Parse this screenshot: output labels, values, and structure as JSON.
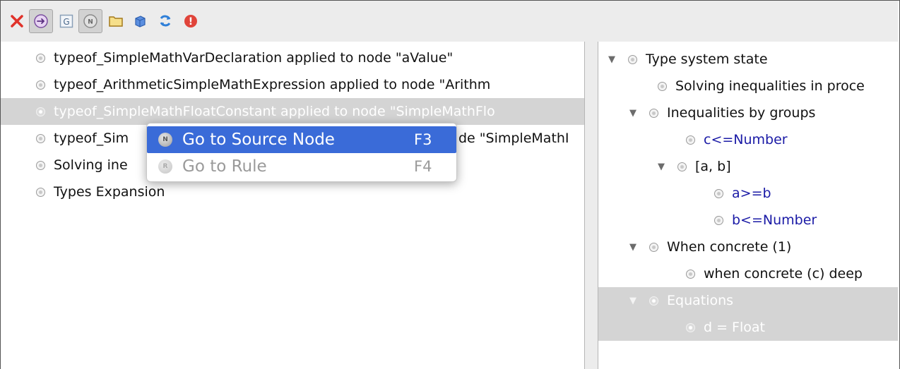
{
  "toolbar": {
    "buttons": [
      {
        "icon": "close-x-icon",
        "color": "#e0322a"
      },
      {
        "icon": "navigate-arrow-icon",
        "pressed": true
      },
      {
        "icon": "g-box-icon",
        "glyph": "G"
      },
      {
        "icon": "n-node-icon",
        "glyph": "N",
        "pressed": true
      },
      {
        "icon": "folder-icon"
      },
      {
        "icon": "cube-icon"
      },
      {
        "icon": "refresh-icon"
      },
      {
        "icon": "error-icon",
        "glyph": "!"
      }
    ]
  },
  "trace": {
    "rows": [
      {
        "label": "typeof_SimpleMathVarDeclaration applied to node \"aValue\""
      },
      {
        "label": "typeof_ArithmeticSimpleMathExpression applied to node \"Arithm"
      },
      {
        "label": "typeof_SimpleMathFloatConstant applied to node \"SimpleMathFlo",
        "selected": true
      },
      {
        "label_start": "typeof_Sim",
        "label_end": "de \"SimpleMathI"
      },
      {
        "label_start": "Solving ine"
      },
      {
        "label": "Types Expansion"
      }
    ]
  },
  "state_tree": {
    "nodes": [
      {
        "label": "Type system state",
        "expanded": true
      },
      {
        "label": "Solving inequalities in proce"
      },
      {
        "label": "Inequalities by groups",
        "expanded": true
      },
      {
        "label": "c<=Number",
        "blue": true
      },
      {
        "label": "[a, b]",
        "expanded": true
      },
      {
        "label": "a>=b",
        "blue": true
      },
      {
        "label": "b<=Number",
        "blue": true
      },
      {
        "label": "When concrete (1)",
        "expanded": true
      },
      {
        "label": "when concrete (c) deep"
      },
      {
        "label": "Equations",
        "expanded": true,
        "selected": true
      },
      {
        "label": "d = Float",
        "selected": true
      }
    ]
  },
  "context_menu": {
    "items": [
      {
        "label": "Go to Source Node",
        "shortcut": "F3",
        "active": true,
        "icon": "n-node-icon"
      },
      {
        "label": "Go to Rule",
        "shortcut": "F4",
        "disabled": true,
        "icon": "rule-icon"
      }
    ]
  },
  "colors": {
    "accent": "#3a6bd8",
    "selection": "#d4d4d4",
    "type_text": "#1a1aa6",
    "error": "#e0322a"
  }
}
